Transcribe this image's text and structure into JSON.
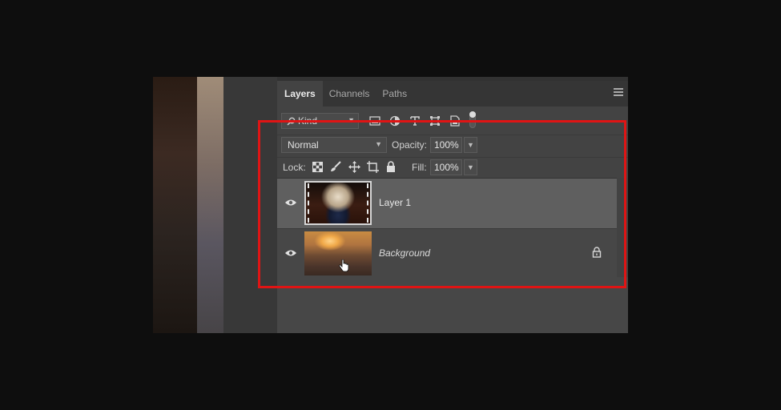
{
  "tabs": [
    {
      "label": "Layers",
      "active": true
    },
    {
      "label": "Channels",
      "active": false
    },
    {
      "label": "Paths",
      "active": false
    }
  ],
  "filter": {
    "kind_label": "Kind",
    "icons": [
      "image-filter-icon",
      "adjustment-filter-icon",
      "type-filter-icon",
      "shape-filter-icon",
      "smart-object-filter-icon"
    ]
  },
  "blend": {
    "mode": "Normal",
    "opacity_label": "Opacity:",
    "opacity_value": "100%"
  },
  "lock": {
    "label": "Lock:",
    "icons": [
      "lock-transparent-pixels-icon",
      "lock-image-pixels-icon",
      "lock-position-icon",
      "lock-artboard-icon",
      "lock-all-icon"
    ],
    "fill_label": "Fill:",
    "fill_value": "100%"
  },
  "layers": [
    {
      "name": "Layer 1",
      "selected": true,
      "visible": true
    },
    {
      "name": "Background",
      "selected": false,
      "visible": true,
      "locked": true
    }
  ],
  "colors": {
    "panel_bg": "#434343",
    "selected_layer": "#5f5f5f",
    "highlight": "#e01414"
  }
}
